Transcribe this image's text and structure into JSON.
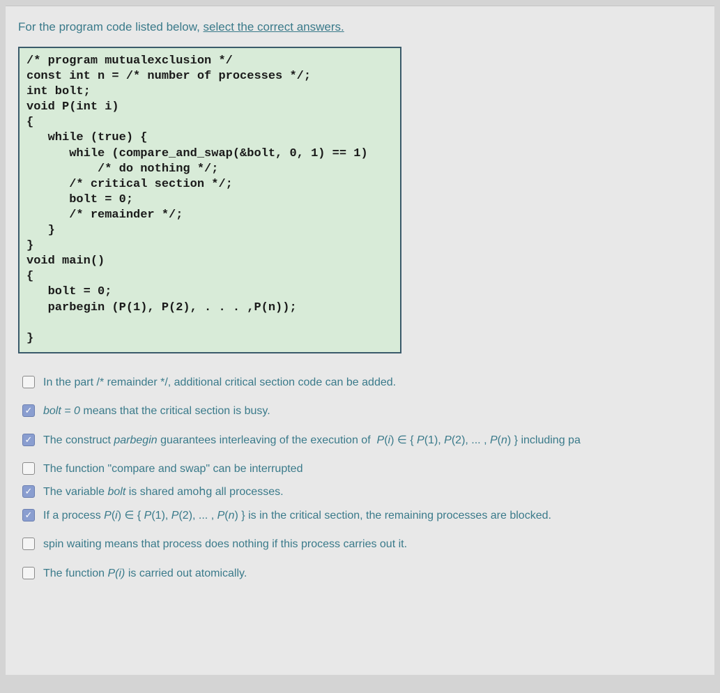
{
  "question": {
    "prefix": "For the program code listed below, ",
    "underlined": "select the correct answers."
  },
  "code": "/* program mutualexclusion */\nconst int n = /* number of processes */;\nint bolt;\nvoid P(int i)\n{\n   while (true) {\n      while (compare_and_swap(&bolt, 0, 1) == 1)\n          /* do nothing */;\n      /* critical section */;\n      bolt = 0;\n      /* remainder */;\n   }\n}\nvoid main()\n{\n   bolt = 0;\n   parbegin (P(1), P(2), . . . ,P(n));\n\n}",
  "options": [
    {
      "checked": false,
      "html": "In the part /* remainder */, additional critical section code can be added."
    },
    {
      "checked": true,
      "html": "<i>bolt = 0</i> means that the critical section is busy."
    },
    {
      "checked": true,
      "html": "The construct <i>parbegin</i> guarantees interleaving of the execution of &nbsp;<i>P</i>(<i>i</i>) ∈ { <i>P</i>(1), <i>P</i>(2), ... , <i>P</i>(<i>n</i>) } including pa"
    },
    {
      "checked": false,
      "html": "The function \"compare and swap\" can be interrupted"
    },
    {
      "checked": true,
      "html": "The variable <i>bolt</i> is shared amo&#x1D5C1;g all processes."
    },
    {
      "checked": true,
      "html": "If a process <i>P</i>(<i>i</i>) ∈ { <i>P</i>(1), <i>P</i>(2), ... , <i>P</i>(<i>n</i>) } is in the critical section, the remaining processes are blocked."
    },
    {
      "checked": false,
      "html": "spin waiting means that process does nothing if this process carries out it."
    },
    {
      "checked": false,
      "html": "The function <i>P(i)</i> is carried out atomically."
    }
  ]
}
